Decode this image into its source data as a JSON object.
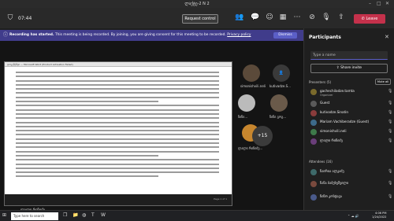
{
  "window": {
    "title": "ლაქტე-2 N 2"
  },
  "toolbar": {
    "timer": "07:44",
    "request_control": "Request control",
    "leave": "Leave",
    "icons": [
      "shield-icon",
      "people-icon",
      "chat-icon",
      "reactions-icon",
      "rooms-icon",
      "more-icon",
      "camera-off-icon",
      "mic-off-icon",
      "share-icon"
    ]
  },
  "banner": {
    "bold": "Recording has started.",
    "text": " This meeting is being recorded. By joining, you are giving consent for this meeting to be recorded.",
    "link": "Privacy policy",
    "dismiss": "Dismiss"
  },
  "doc": {
    "window_title": "დოკუმენტი — Microsoft Word (Product Activation Failed)",
    "pager": "Page 1 of 1"
  },
  "tiles": [
    {
      "name": "simonishvili.neli"
    },
    {
      "name": "kutivadze.S..."
    },
    {
      "name": "ნინი..."
    },
    {
      "name": "ხანი ძე..."
    },
    {
      "name": "ნინი გოგ..."
    },
    {
      "name": "ლალი რიჩიძე..."
    }
  ],
  "plus_count": "+15",
  "lower_name": "ლალი რიჩიძე",
  "panel": {
    "title": "Participants",
    "search_placeholder": "Type a name",
    "share_invite": "Share invite",
    "presenters_label": "Presenters (5)",
    "mute_all": "Mute all",
    "presenters": [
      {
        "name": "gachechiladze.tamta",
        "role": "Organizer",
        "color": "#7a6a2c"
      },
      {
        "name": "Guest",
        "role": "",
        "color": "#5a5a5a"
      },
      {
        "name": "kutivadze.Sinatin",
        "role": "",
        "color": "#8a3c3c"
      },
      {
        "name": "Mariam Vachiberadze (Guest)",
        "role": "",
        "color": "#3d6a8a"
      },
      {
        "name": "simonishvili.neli",
        "role": "",
        "color": "#3e7a4a"
      },
      {
        "name": "ლალი რიჩიძე",
        "role": "",
        "color": "#6a3e7a"
      }
    ],
    "attendees_label": "Attendees (16)",
    "attendees": [
      {
        "name": "ნაირია ალკაძე",
        "color": "#3e6a6a"
      },
      {
        "name": "ნანა ბაბუხეშვილი",
        "color": "#7a4a3e"
      },
      {
        "name": "ნინო კოსტავა",
        "color": "#4a5a8a"
      }
    ]
  },
  "taskbar": {
    "search": "Type here to search",
    "time": "4:06 PM",
    "date": "1/24/2022"
  }
}
